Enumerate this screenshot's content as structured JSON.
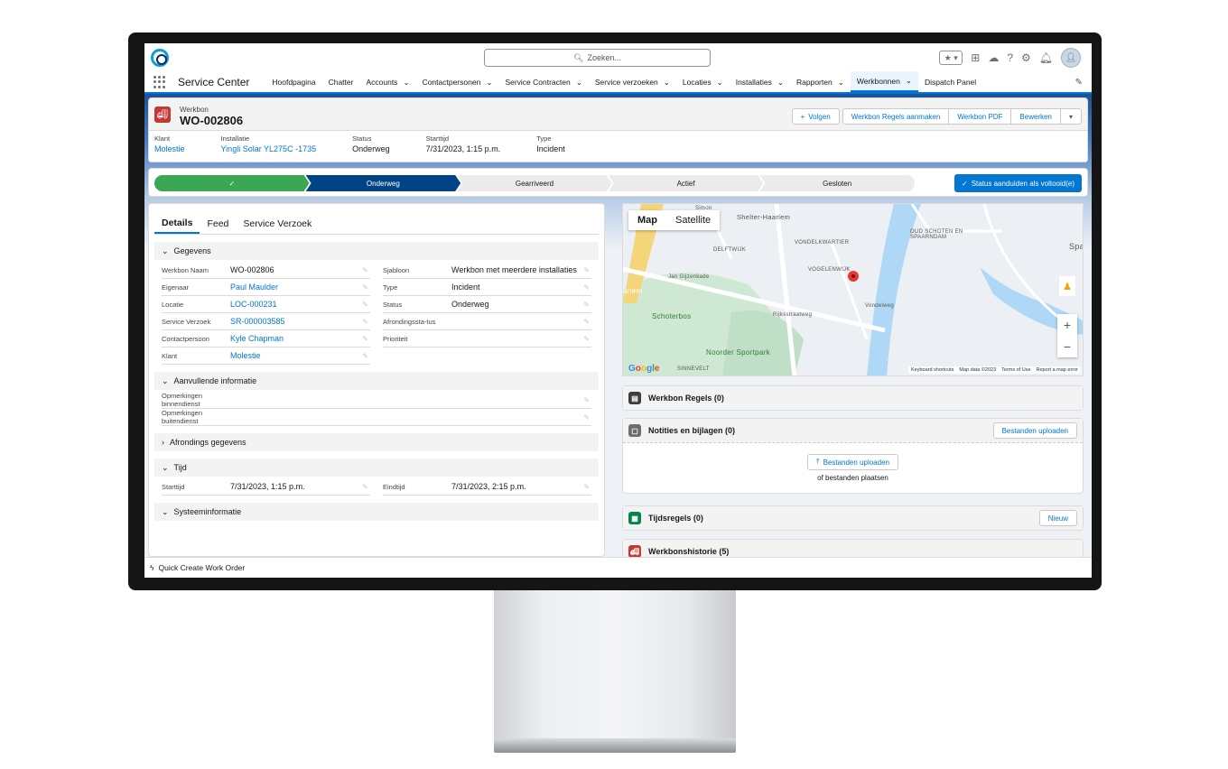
{
  "search": {
    "placeholder": "Zoeken..."
  },
  "nav": {
    "app_name": "Service Center",
    "items": [
      {
        "label": "Hoofdpagina",
        "chevron": false
      },
      {
        "label": "Chatter",
        "chevron": false
      },
      {
        "label": "Accounts",
        "chevron": true
      },
      {
        "label": "Contactpersonen",
        "chevron": true
      },
      {
        "label": "Service Contracten",
        "chevron": true
      },
      {
        "label": "Service verzoeken",
        "chevron": true
      },
      {
        "label": "Locaties",
        "chevron": true
      },
      {
        "label": "Installaties",
        "chevron": true
      },
      {
        "label": "Rapporten",
        "chevron": true
      },
      {
        "label": "Werkbonnen",
        "chevron": true,
        "active": true
      },
      {
        "label": "Dispatch Panel",
        "chevron": false
      }
    ]
  },
  "record": {
    "type_label": "Werkbon",
    "title": "WO-002806",
    "buttons": {
      "follow": "Volgen",
      "create_lines": "Werkbon Regels aanmaken",
      "pdf": "Werkbon PDF",
      "edit": "Bewerken"
    },
    "highlights": [
      {
        "label": "Klant",
        "value": "Molestie",
        "link": true
      },
      {
        "label": "Installatie",
        "value": "Yingli Solar YL275C -1735",
        "link": true
      },
      {
        "label": "Status",
        "value": "Onderweg",
        "link": false
      },
      {
        "label": "Starttijd",
        "value": "7/31/2023, 1:15 p.m.",
        "link": false
      },
      {
        "label": "Type",
        "value": "Incident",
        "link": false
      }
    ]
  },
  "path": {
    "stages": [
      "✓",
      "Onderweg",
      "Gearriveerd",
      "Actief",
      "Gesloten"
    ],
    "action": "Status aanduiden als voltooid(e)"
  },
  "details": {
    "tabs": [
      "Details",
      "Feed",
      "Service Verzoek"
    ],
    "sections": {
      "gegevens": "Gegevens",
      "aanvullend": "Aanvullende informatie",
      "afronding": "Afrondings gegevens",
      "tijd": "Tijd",
      "systeem": "Systeeminformatie"
    },
    "left_fields": [
      {
        "label": "Werkbon Naam",
        "value": "WO-002806"
      },
      {
        "label": "Eigenaar",
        "value": "Paul Maulder"
      },
      {
        "label": "Locatie",
        "value": "LOC-000231"
      },
      {
        "label": "Service Verzoek",
        "value": "SR-000003585"
      },
      {
        "label": "Contactpersoon",
        "value": "Kyle Chapman"
      },
      {
        "label": "Klant",
        "value": "Molestie"
      }
    ],
    "right_fields": [
      {
        "label": "Sjabloon",
        "value": "Werkbon met meerdere installaties"
      },
      {
        "label": "Type",
        "value": "Incident"
      },
      {
        "label": "Status",
        "value": "Onderweg"
      },
      {
        "label": "Afrondingssta-tus",
        "value": ""
      },
      {
        "label": "Prioriteit",
        "value": ""
      }
    ],
    "extra_fields": [
      {
        "label": "Opmerkingen binnendienst",
        "value": ""
      },
      {
        "label": "Opmerkingen buitendienst",
        "value": ""
      }
    ],
    "time_fields": [
      {
        "label": "Starttijd",
        "value": "7/31/2023, 1:15 p.m."
      },
      {
        "label": "Eindtijd",
        "value": "7/31/2023, 2:15 p.m."
      }
    ]
  },
  "map": {
    "tabs": [
      "Map",
      "Satellite"
    ],
    "labels": [
      "Simon",
      "Shelter-Haarlem",
      "DELFTWIJK",
      "VONDELKWARTIER",
      "VOGELENWIJK",
      "OUD SCHOTEN EN SPAARNDAM",
      "Schoterbos",
      "Noorder Sportpark",
      "Jan Gijzenkade",
      "Rijksstraatweg",
      "Vondelweg",
      "SINNEVELT",
      "Spa",
      "arlem"
    ],
    "footer": [
      "Keyboard shortcuts",
      "Map data ©2023",
      "Terms of Use",
      "Report a map error"
    ],
    "brand": "Google"
  },
  "cards": {
    "regels": "Werkbon Regels (0)",
    "notities": "Notities en bijlagen (0)",
    "upload": "Bestanden uploaden",
    "drop_hint": "of bestanden plaatsen",
    "tijdsregels": "Tijdsregels (0)",
    "nieuw": "Nieuw",
    "historie": "Werkbonshistorie (5)"
  },
  "utility": {
    "label": "Quick Create Work Order"
  },
  "colors": {
    "brand": "#0176d3",
    "path_done": "#3ba755",
    "path_current": "#014486",
    "record_icon": "#c23934"
  }
}
